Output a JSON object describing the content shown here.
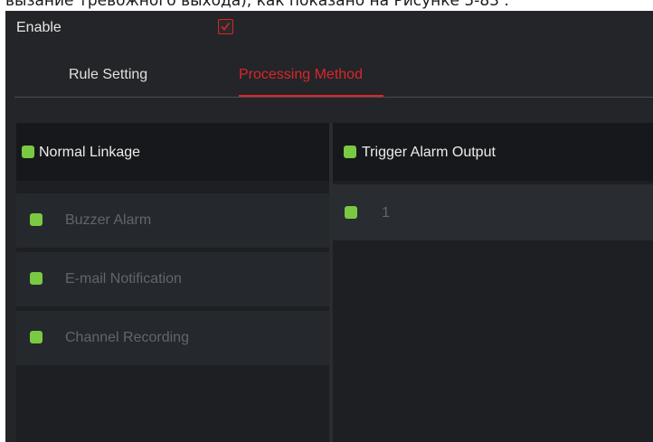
{
  "document_text": "вызание тревожного выхода), как показано на Рисунке 5-83 .",
  "enable": {
    "label": "Enable",
    "checked": true
  },
  "tabs": [
    {
      "label": "Rule Setting",
      "active": false
    },
    {
      "label": "Processing Method",
      "active": true
    }
  ],
  "normal_linkage": {
    "title": "Normal Linkage",
    "items": [
      {
        "label": "Buzzer Alarm"
      },
      {
        "label": "E-mail Notification"
      },
      {
        "label": "Channel Recording"
      }
    ]
  },
  "trigger_alarm_output": {
    "title": "Trigger Alarm Output",
    "items": [
      {
        "label": "1"
      }
    ]
  },
  "colors": {
    "accent_red": "#d9262c",
    "check_green": "#7ac943",
    "panel_bg": "#232528"
  }
}
